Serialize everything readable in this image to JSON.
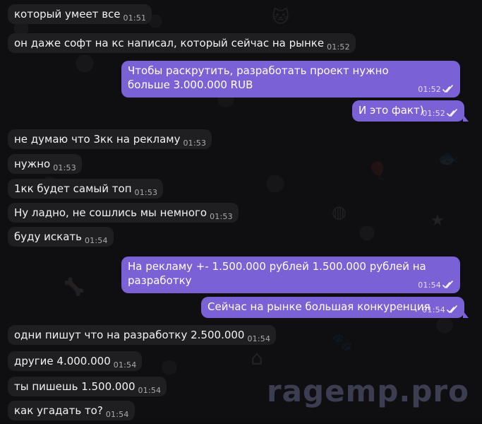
{
  "messages": [
    {
      "side": "in",
      "text": "который умеет все",
      "time": "01:51"
    },
    {
      "side": "in",
      "text": "он даже софт на кс написал, который сейчас на рынке",
      "time": "01:52"
    },
    {
      "side": "out",
      "text": "Чтобы раскрутить, разработать проект нужно больше 3.000.000 RUB",
      "time": "01:52"
    },
    {
      "side": "out",
      "text": "И это факт)",
      "time": "01:52"
    },
    {
      "side": "in",
      "text": "не думаю что 3кк на рекламу",
      "time": "01:53"
    },
    {
      "side": "in",
      "text": "нужно",
      "time": "01:53"
    },
    {
      "side": "in",
      "text": "1кк будет самый топ",
      "time": "01:53"
    },
    {
      "side": "in",
      "text": "Ну ладно, не сошлись мы немного",
      "time": "01:53"
    },
    {
      "side": "in",
      "text": "буду искать",
      "time": "01:54"
    },
    {
      "side": "out",
      "text": "На рекламу +- 1.500.000 рублей 1.500.000 рублей на разработку",
      "time": "01:54"
    },
    {
      "side": "out",
      "text": "Сейчас на рынке большая конкуренция",
      "time": "01:54"
    },
    {
      "side": "in",
      "text": "одни пишут что на разработку 2.500.000",
      "time": "01:54"
    },
    {
      "side": "in",
      "text": "другие 4.000.000",
      "time": "01:54"
    },
    {
      "side": "in",
      "text": "ты пишешь 1.500.000",
      "time": "01:54"
    },
    {
      "side": "in",
      "text": "как угадать то?",
      "time": "01:54"
    }
  ],
  "watermark": "ragemp.pro",
  "colors": {
    "incoming_bubble": "#1f1f22",
    "outgoing_bubble": "#7a61d6",
    "background": "#0f0f12"
  }
}
